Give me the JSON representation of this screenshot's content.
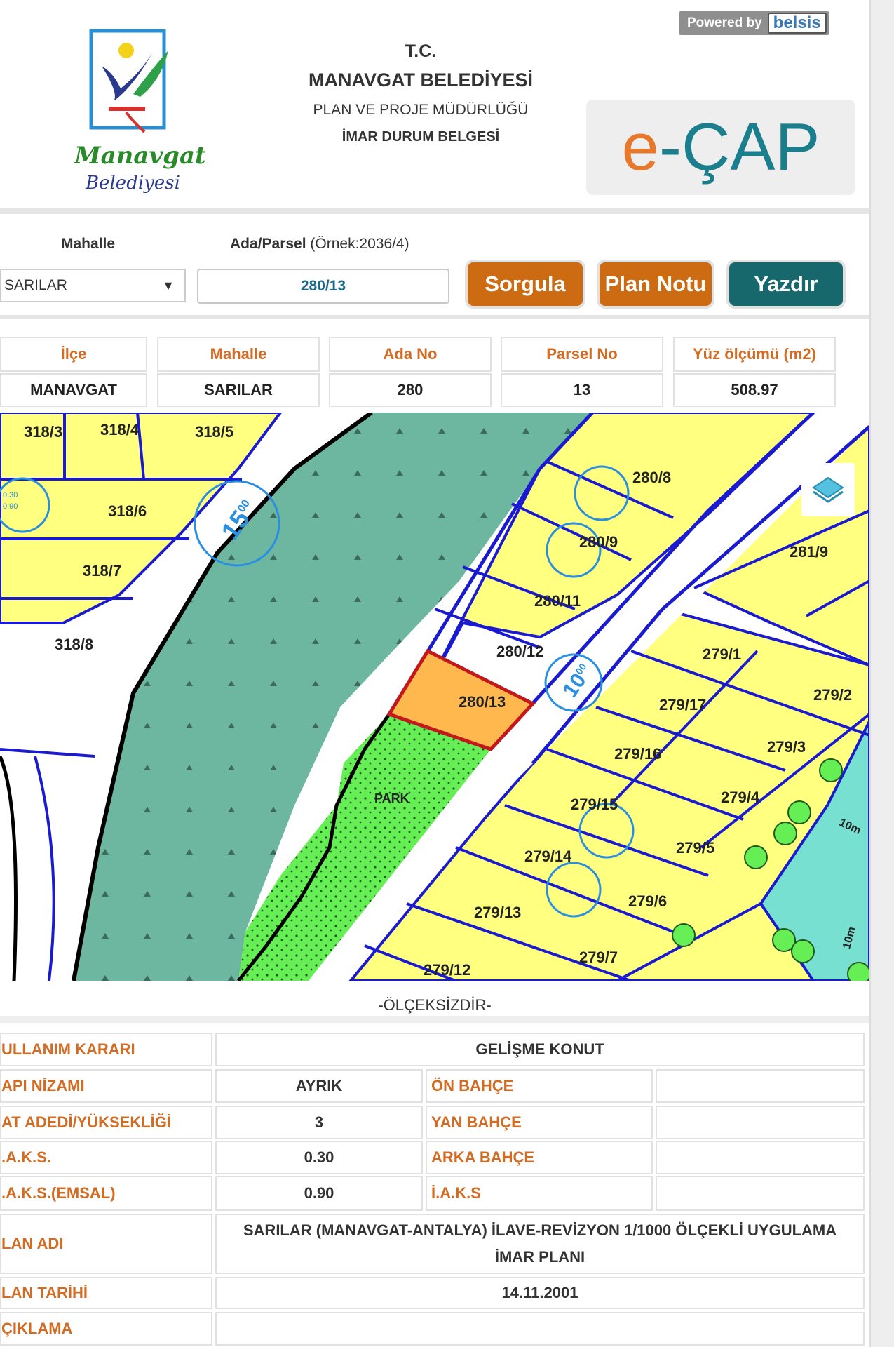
{
  "header": {
    "logo_text": "Manavgat",
    "logo_subtext": "Belediyesi",
    "line1": "T.C.",
    "line2": "MANAVGAT BELEDİYESİ",
    "line3": "PLAN VE PROJE MÜDÜRLÜĞÜ",
    "line4": "İMAR DURUM BELGESİ",
    "powered_by": "Powered by",
    "powered_brand": "belsis",
    "ecap_e": "e",
    "ecap_rest": "-ÇAP"
  },
  "search": {
    "mahalle_label": "Mahalle",
    "ada_label": "Ada/Parsel",
    "ada_hint": "(Örnek:2036/4)",
    "mahalle_value": "SARILAR",
    "ada_value": "280/13",
    "btn_sorgula": "Sorgula",
    "btn_plan_notu": "Plan Notu",
    "btn_yazdir": "Yazdır"
  },
  "parcel": {
    "headers": [
      "İlçe",
      "Mahalle",
      "Ada No",
      "Parsel No",
      "Yüz ölçümü (m2)"
    ],
    "values": [
      "MANAVGAT",
      "SARILAR",
      "280",
      "13",
      "508.97"
    ]
  },
  "map": {
    "labels": [
      "318/3",
      "318/4",
      "318/5",
      "318/6",
      "318/7",
      "318/8",
      "280/8",
      "280/9",
      "280/11",
      "280/12",
      "280/13",
      "281/9",
      "279/1",
      "279/2",
      "279/17",
      "279/3",
      "279/16",
      "279/4",
      "279/15",
      "279/5",
      "279/14",
      "279/6",
      "279/13",
      "279/7",
      "279/12"
    ],
    "park_label": "PARK",
    "road_15": "15",
    "road_15_sub": "00",
    "road_10": "10",
    "road_10_sub": "00",
    "road_10m_a": "10m",
    "road_10m_b": "10m",
    "ratio_a1": "0.30",
    "ratio_a2": "0.90",
    "scale_note": "-ÖLÇEKSİZDİR-"
  },
  "zoning": {
    "kullanim_label": "ULLANIM KARARI",
    "kullanim_value": "GELİŞME KONUT",
    "yapi_label": "API NİZAMI",
    "yapi_value": "AYRIK",
    "kat_label": "AT ADEDİ/YÜKSEKLİĞİ",
    "kat_value": "3",
    "taks_label": ".A.K.S.",
    "taks_value": "0.30",
    "kaks_label": ".A.K.S.(EMSAL)",
    "kaks_value": "0.90",
    "on_bahce": "ÖN BAHÇE",
    "yan_bahce": "YAN BAHÇE",
    "arka_bahce": "ARKA BAHÇE",
    "iaks": "İ.A.K.S",
    "plan_adi_label": "LAN ADI",
    "plan_adi_value": "SARILAR (MANAVGAT-ANTALYA) İLAVE-REVİZYON 1/1000 ÖLÇEKLİ UYGULAMA İMAR PLANI",
    "plan_tarihi_label": "LAN TARİHİ",
    "plan_tarihi_value": "14.11.2001",
    "aciklama_label": "ÇIKLAMA"
  }
}
